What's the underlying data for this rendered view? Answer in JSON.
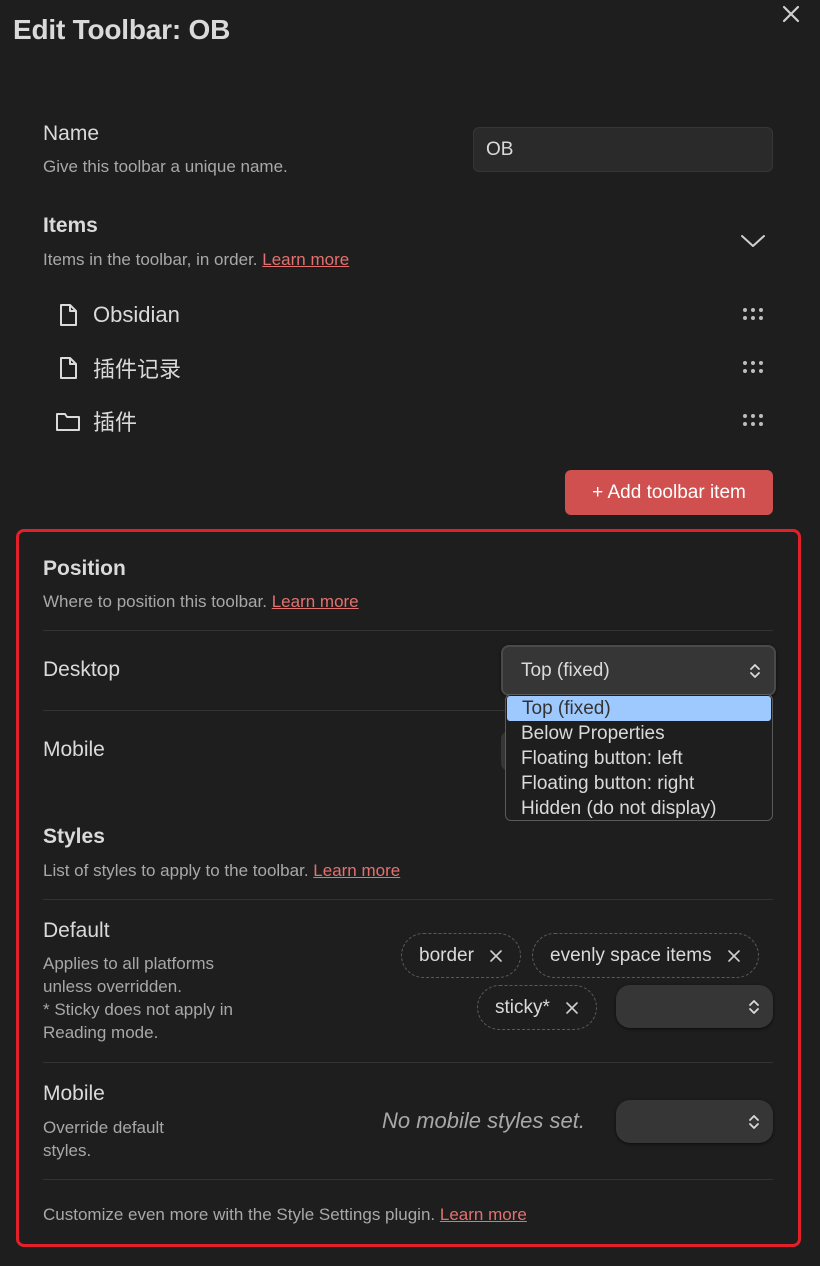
{
  "dialog": {
    "title": "Edit Toolbar: OB"
  },
  "name_setting": {
    "label": "Name",
    "description": "Give this toolbar a unique name.",
    "value": "OB"
  },
  "items_setting": {
    "label": "Items",
    "description": "Items in the toolbar, in order.",
    "learn_more": "Learn more",
    "items": [
      {
        "label": "Obsidian",
        "icon": "file-icon"
      },
      {
        "label": "插件记录",
        "icon": "file-icon"
      },
      {
        "label": "插件",
        "icon": "folder-icon"
      }
    ],
    "add_button": "+ Add toolbar item"
  },
  "position": {
    "heading": "Position",
    "description": "Where to position this toolbar.",
    "learn_more": "Learn more",
    "desktop_label": "Desktop",
    "desktop_value": "Top (fixed)",
    "mobile_label": "Mobile",
    "options": [
      "Top (fixed)",
      "Below Properties",
      "Floating button: left",
      "Floating button: right",
      "Hidden (do not display)"
    ]
  },
  "styles": {
    "heading": "Styles",
    "description": "List of styles to apply to the toolbar.",
    "learn_more": "Learn more",
    "default_label": "Default",
    "default_desc_1": "Applies to all platforms",
    "default_desc_2": "unless overridden.",
    "default_desc_3": "* Sticky does not apply in",
    "default_desc_4": "Reading mode.",
    "default_chips": [
      "border",
      "evenly space items",
      "sticky*"
    ],
    "mobile_label": "Mobile",
    "mobile_desc_1": "Override default",
    "mobile_desc_2": "styles.",
    "mobile_empty": "No mobile styles set."
  },
  "footer": {
    "text": "Customize even more with the Style Settings plugin.",
    "learn_more": "Learn more"
  },
  "colors": {
    "background": "#1e1e1e",
    "accent": "#d04f4f",
    "link": "#e3716f",
    "highlight_border": "#e3202a",
    "selected_option": "#9ec9ff"
  }
}
